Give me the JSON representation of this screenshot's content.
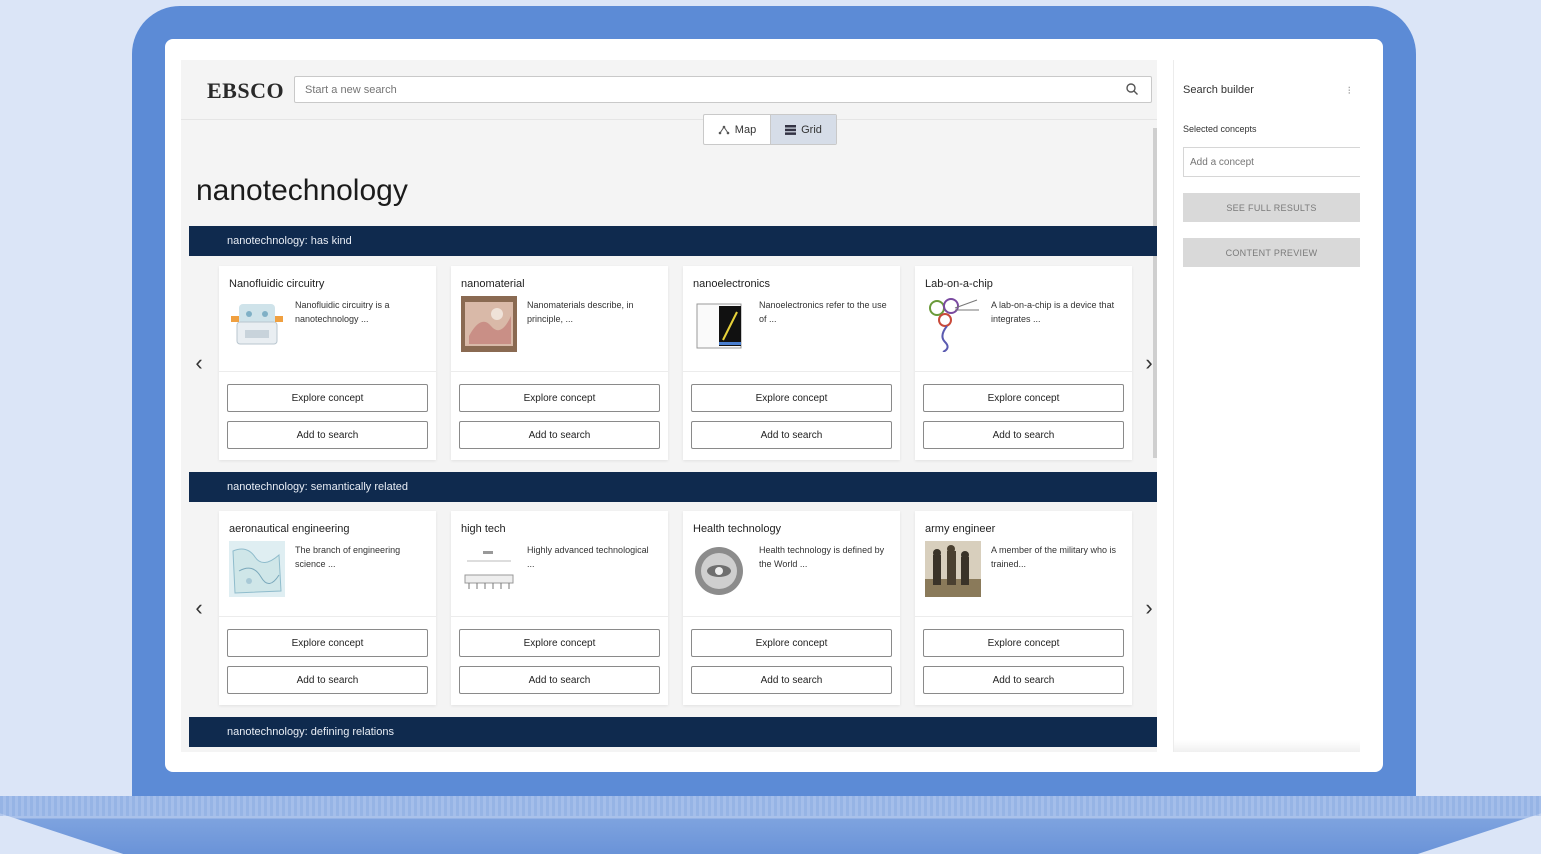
{
  "header": {
    "logo": "EBSCO",
    "search_placeholder": "Start a new search"
  },
  "view_toggle": {
    "map_label": "Map",
    "grid_label": "Grid",
    "selected": "Grid"
  },
  "page_title": "nanotechnology",
  "sections": [
    {
      "title": "nanotechnology: has kind",
      "cards": [
        {
          "title": "Nanofluidic circuitry",
          "desc": "Nanofluidic circuitry is a nanotechnology ...",
          "thumb_icon": "device-icon"
        },
        {
          "title": "nanomaterial",
          "desc": "Nanomaterials describe, in principle, ...",
          "thumb_icon": "material-photo-icon"
        },
        {
          "title": "nanoelectronics",
          "desc": "Nanoelectronics refer to the use of ...",
          "thumb_icon": "electronics-icon"
        },
        {
          "title": "Lab-on-a-chip",
          "desc": "A lab-on-a-chip is a device that integrates ...",
          "thumb_icon": "chip-diagram-icon"
        }
      ]
    },
    {
      "title": "nanotechnology: semantically related",
      "cards": [
        {
          "title": "aeronautical engineering",
          "desc": "The branch of engineering science ...",
          "thumb_icon": "map-icon"
        },
        {
          "title": "high tech",
          "desc": "Highly advanced technological ...",
          "thumb_icon": "ruler-icon"
        },
        {
          "title": "Health technology",
          "desc": "Health technology is defined by the World ...",
          "thumb_icon": "badge-photo-icon"
        },
        {
          "title": "army engineer",
          "desc": "A member of the military who is trained...",
          "thumb_icon": "soldiers-photo-icon"
        }
      ]
    },
    {
      "title": "nanotechnology: defining relations",
      "cards": []
    }
  ],
  "card_buttons": {
    "explore": "Explore concept",
    "add": "Add to search"
  },
  "sidebar": {
    "title": "Search builder",
    "selected_label": "Selected concepts",
    "add_placeholder": "Add a concept",
    "see_full_results": "SEE FULL RESULTS",
    "content_preview": "CONTENT PREVIEW"
  },
  "colors": {
    "section_bar": "#0f2a4e",
    "laptop_frame": "#5c8bd6",
    "background": "#dbe5f7",
    "toggle_active": "#d6dde8"
  }
}
